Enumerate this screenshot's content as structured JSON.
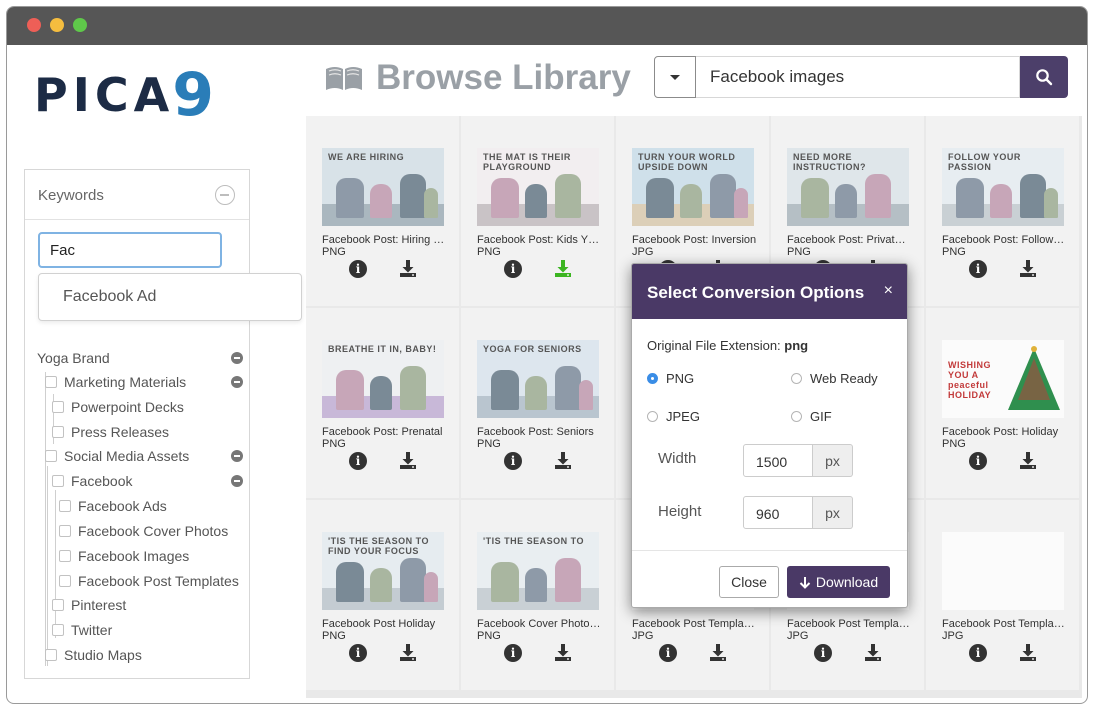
{
  "brand": {
    "logo_main": "PICA",
    "logo_nine": "9"
  },
  "page": {
    "title": "Browse Library"
  },
  "search": {
    "value": "Facebook images",
    "button_icon": "search-icon"
  },
  "sidebar": {
    "keywords_label": "Keywords",
    "keyword_input": "Fac",
    "autocomplete": [
      "Facebook Ad"
    ],
    "tree": [
      {
        "label": "Yoga Brand"
      },
      {
        "label": "Marketing Materials"
      },
      {
        "label": "Powerpoint Decks"
      },
      {
        "label": "Press Releases"
      },
      {
        "label": "Social Media Assets"
      },
      {
        "label": "Facebook"
      },
      {
        "label": "Facebook Ads"
      },
      {
        "label": "Facebook Cover Photos"
      },
      {
        "label": "Facebook Images"
      },
      {
        "label": "Facebook Post Templates"
      },
      {
        "label": "Pinterest"
      },
      {
        "label": "Twitter"
      },
      {
        "label": "Studio Maps"
      }
    ]
  },
  "assets": [
    {
      "title": "Facebook Post: Hiring …",
      "format": "PNG",
      "caption": "WE ARE HIRING"
    },
    {
      "title": "Facebook Post: Kids Y…",
      "format": "PNG",
      "caption": "THE MAT IS THEIR PLAYGROUND"
    },
    {
      "title": "Facebook Post: Inversion",
      "format": "JPG",
      "caption": "TURN YOUR WORLD UPSIDE DOWN"
    },
    {
      "title": "Facebook Post: Privat…",
      "format": "PNG",
      "caption": "NEED MORE INSTRUCTION?"
    },
    {
      "title": "Facebook Post: Follow…",
      "format": "PNG",
      "caption": "FOLLOW YOUR PASSION"
    },
    {
      "title": "Facebook Post: Prenatal",
      "format": "PNG",
      "caption": "BREATHE IT IN, BABY!"
    },
    {
      "title": "Facebook Post: Seniors",
      "format": "PNG",
      "caption": "YOGA FOR SENIORS"
    },
    {
      "title": "",
      "format": "",
      "caption": ""
    },
    {
      "title": "",
      "format": "",
      "caption": ""
    },
    {
      "title": "Facebook Post: Holiday",
      "format": "PNG",
      "caption": "WISHING YOU A peaceful HOLIDAY"
    },
    {
      "title": "Facebook Post Holiday",
      "format": "PNG",
      "caption": "'TIS THE SEASON TO FIND YOUR FOCUS"
    },
    {
      "title": "Facebook Cover Photo…",
      "format": "PNG",
      "caption": "'TIS THE SEASON TO"
    },
    {
      "title": "Facebook Post Templa…",
      "format": "JPG",
      "caption": ""
    },
    {
      "title": "Facebook Post Templa…",
      "format": "JPG",
      "caption": ""
    },
    {
      "title": "Facebook Post Templa…",
      "format": "JPG",
      "caption": ""
    }
  ],
  "modal": {
    "title": "Select Conversion Options",
    "close_glyph": "×",
    "original_label": "Original File Extension:",
    "original_value": "png",
    "options": {
      "png": "PNG",
      "web": "Web Ready",
      "jpeg": "JPEG",
      "gif": "GIF"
    },
    "selected": "PNG",
    "width_label": "Width",
    "width_value": "1500",
    "height_label": "Height",
    "height_value": "960",
    "unit": "px",
    "close_label": "Close",
    "download_label": "Download"
  },
  "colors": {
    "accent": "#4a3966",
    "active_download": "#3cb521"
  }
}
